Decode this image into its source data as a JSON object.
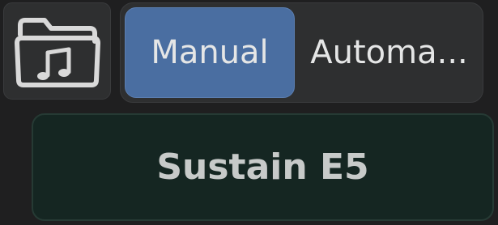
{
  "toolbar": {
    "folder_icon": "music-folder-icon"
  },
  "mode_selector": {
    "options": [
      {
        "label": "Manual",
        "selected": true
      },
      {
        "label": "Automa...",
        "selected": false
      }
    ]
  },
  "sustain": {
    "label": "Sustain E5"
  },
  "colors": {
    "background": "#1f1f20",
    "panel": "#2e2f30",
    "accent": "#4a6ea1",
    "sustain_bg": "#152622",
    "text": "#e5e6e6"
  }
}
